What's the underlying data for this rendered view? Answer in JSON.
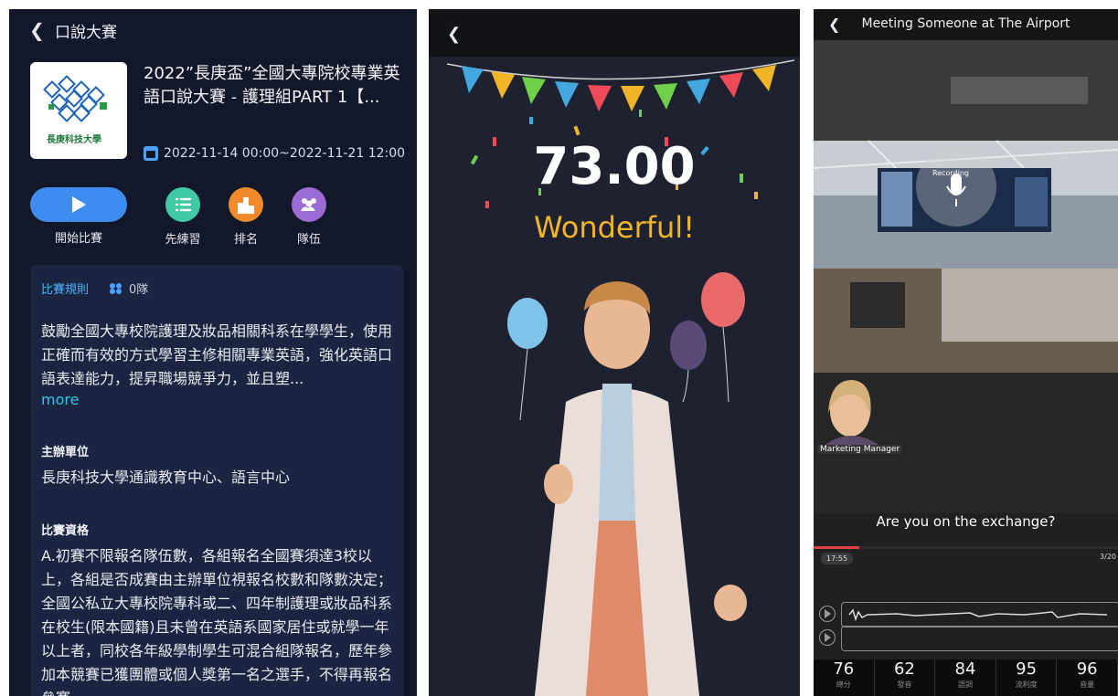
{
  "panel1": {
    "header_title": "口說大賽",
    "logo_text": "長庚科技大學",
    "competition_title": "2022”長庚盃”全國大專院校專業英語口說大賽 - 護理組PART 1【...",
    "date_range": "2022-11-14 00:00~2022-11-21 12:00",
    "actions": [
      {
        "label": "開始比賽",
        "icon": "play-icon",
        "color": "#3d8cf0"
      },
      {
        "label": "先練習",
        "icon": "list-icon",
        "color": "#3fc9a4"
      },
      {
        "label": "排名",
        "icon": "podium-icon",
        "color": "#f08a2a"
      },
      {
        "label": "隊伍",
        "icon": "team-icon",
        "color": "#9b6bd8"
      }
    ],
    "rules_tab": "比賽規則",
    "team_count": "0隊",
    "description": "鼓勵全國大專校院護理及妝品相關科系在學學生，使用正確而有效的方式學習主修相關專業英語，強化英語口語表達能力，提昇職場競爭力，並且塑...",
    "more": "more",
    "organizer_heading": "主辦單位",
    "organizer": "長庚科技大學通識教育中心、語言中心",
    "eligibility_heading": "比賽資格",
    "eligibility": "A.初賽不限報名隊伍數，各組報名全國賽須達3校以上，各組是否成賽由主辦單位視報名校數和隊數決定；全國公私立大專校院專科或二、四年制護理或妝品科系在校生(限本國籍)且未曾在英語系國家居住或就學一年以上者，同校各年級學制學生可混合組隊報名，歷年參加本競賽已獲團體或個人獎第一名之選手，不得再報名參賽"
  },
  "panel2": {
    "score": "73.00",
    "rating": "Wonderful!",
    "colors": {
      "flag_yellow": "#f2b52a",
      "flag_blue": "#43a8e0",
      "flag_green": "#6fd04a",
      "flag_red": "#ee4a5a"
    }
  },
  "panel3": {
    "title": "Meeting Someone at The Airport",
    "recording_label": "Recording",
    "avatar_label": "Marketing Manager",
    "question": "Are you on the exchange?",
    "time": "17:55",
    "count": "3/20",
    "progress": 0.15,
    "scores": [
      {
        "value": "76",
        "label": "總分"
      },
      {
        "value": "62",
        "label": "發音"
      },
      {
        "value": "84",
        "label": "語調"
      },
      {
        "value": "95",
        "label": "流利度"
      },
      {
        "value": "96",
        "label": "音量"
      }
    ]
  }
}
